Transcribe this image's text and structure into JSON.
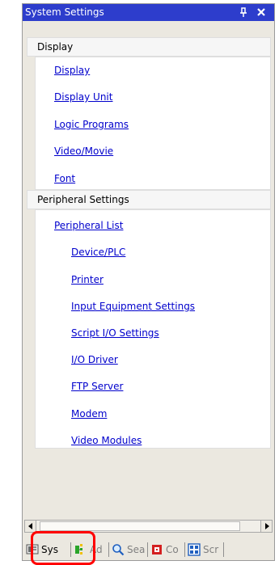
{
  "window": {
    "title": "System Settings"
  },
  "display_group": {
    "header": "Display",
    "items": [
      "Display",
      "Display Unit",
      "Logic Programs",
      "Video/Movie",
      "Font"
    ]
  },
  "peripheral_group": {
    "header": "Peripheral Settings",
    "top_item": "Peripheral List",
    "items": [
      "Device/PLC",
      "Printer",
      "Input Equipment Settings",
      "Script I/O Settings",
      "I/O Driver",
      "FTP Server",
      "Modem",
      "Video Modules"
    ]
  },
  "tabs": [
    {
      "label": "Sys",
      "icon": "system-settings-icon"
    },
    {
      "label": "Ad",
      "icon": "address-icon"
    },
    {
      "label": "Sea",
      "icon": "search-icon"
    },
    {
      "label": "Co",
      "icon": "common-icon"
    },
    {
      "label": "Scr",
      "icon": "screen-list-icon"
    }
  ],
  "colors": {
    "titlebar": "#2d3dcc",
    "link": "#0000cc",
    "highlight": "#ff0000"
  }
}
